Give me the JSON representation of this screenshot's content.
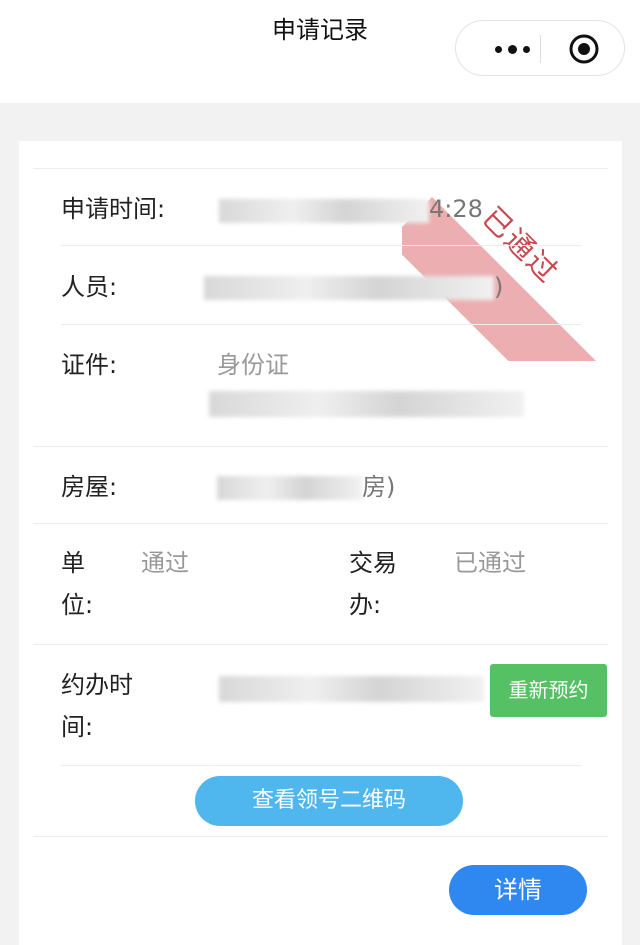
{
  "header": {
    "title": "申请记录"
  },
  "record": {
    "status_stamp": "已通过",
    "apply_time_label": "申请时间:",
    "apply_time_value_partial": "4:28",
    "person_label": "人员:",
    "person_value_partial": ")",
    "id_label": "证件:",
    "id_type": "身份证",
    "house_label": "房屋:",
    "house_value_partial": "房)",
    "unit_label_line1": "单",
    "unit_label_line2": "位:",
    "unit_value": "通过",
    "office_label_line1": "交易",
    "office_label_line2": "办:",
    "office_value": "已通过",
    "appt_label_line1": "约办时",
    "appt_label_line2": "间:",
    "rebook_button": "重新预约",
    "qrcode_button": "查看领号二维码",
    "detail_button": "详情"
  },
  "colors": {
    "green": "#55c164",
    "light_blue": "#4fb6ee",
    "blue": "#2f87f0",
    "stamp": "#e9a0a3"
  }
}
